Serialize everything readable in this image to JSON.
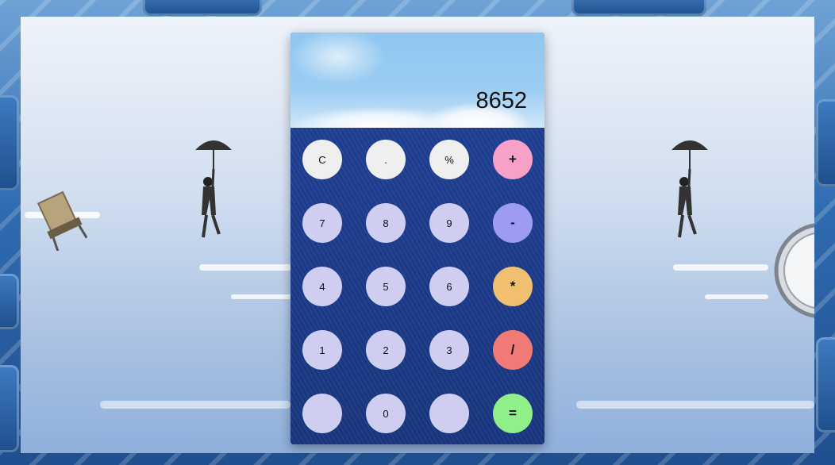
{
  "display": {
    "value": "8652"
  },
  "keypad": {
    "rows": [
      [
        {
          "name": "clear-button",
          "label": "C",
          "color": "#efefef",
          "op": false
        },
        {
          "name": "decimal-button",
          "label": ".",
          "color": "#efefef",
          "op": false
        },
        {
          "name": "percent-button",
          "label": "%",
          "color": "#efefef",
          "op": false
        },
        {
          "name": "add-button",
          "label": "+",
          "color": "#f7a1c9",
          "op": true
        }
      ],
      [
        {
          "name": "digit-7-button",
          "label": "7",
          "color": "#cfcdf0",
          "op": false
        },
        {
          "name": "digit-8-button",
          "label": "8",
          "color": "#cfcdf0",
          "op": false
        },
        {
          "name": "digit-9-button",
          "label": "9",
          "color": "#cfcdf0",
          "op": false
        },
        {
          "name": "subtract-button",
          "label": "-",
          "color": "#9d9cf2",
          "op": true
        }
      ],
      [
        {
          "name": "digit-4-button",
          "label": "4",
          "color": "#cfcdf0",
          "op": false
        },
        {
          "name": "digit-5-button",
          "label": "5",
          "color": "#cfcdf0",
          "op": false
        },
        {
          "name": "digit-6-button",
          "label": "6",
          "color": "#cfcdf0",
          "op": false
        },
        {
          "name": "multiply-button",
          "label": "*",
          "color": "#f0c070",
          "op": true
        }
      ],
      [
        {
          "name": "digit-1-button",
          "label": "1",
          "color": "#cfcdf0",
          "op": false
        },
        {
          "name": "digit-2-button",
          "label": "2",
          "color": "#cfcdf0",
          "op": false
        },
        {
          "name": "digit-3-button",
          "label": "3",
          "color": "#cfcdf0",
          "op": false
        },
        {
          "name": "divide-button",
          "label": "/",
          "color": "#f27a76",
          "op": true
        }
      ],
      [
        {
          "name": "blank-left-button",
          "label": "",
          "color": "#cfcdf0",
          "op": false
        },
        {
          "name": "digit-0-button",
          "label": "0",
          "color": "#cfcdf0",
          "op": false
        },
        {
          "name": "blank-right-button",
          "label": "",
          "color": "#cfcdf0",
          "op": false
        },
        {
          "name": "equals-button",
          "label": "=",
          "color": "#8ff08a",
          "op": true
        }
      ]
    ]
  }
}
